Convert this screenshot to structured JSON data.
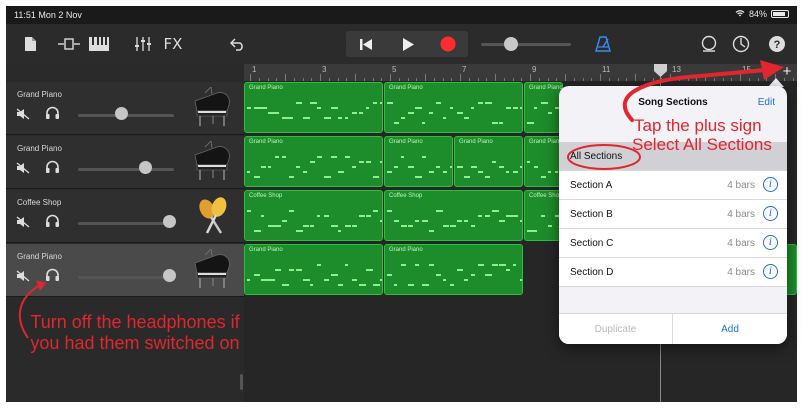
{
  "status_bar": {
    "time_date": "11:51  Mon 2 Nov",
    "battery": "84%"
  },
  "toolbar": {
    "fx_label": "FX"
  },
  "ruler": {
    "bars": [
      "1",
      "3",
      "5",
      "7",
      "9",
      "11",
      "13",
      "15"
    ]
  },
  "tracks": [
    {
      "name": "Grand Piano",
      "instrument": "grand-piano",
      "volume": 0.45
    },
    {
      "name": "Grand Piano",
      "instrument": "grand-piano",
      "volume": 0.7
    },
    {
      "name": "Coffee Shop",
      "instrument": "maracas",
      "volume": 0.95
    },
    {
      "name": "Grand Piano",
      "instrument": "grand-piano",
      "volume": 0.95,
      "selected": true
    }
  ],
  "regions": [
    {
      "track": 0,
      "label": "Grand Piano"
    },
    {
      "track": 0,
      "label": "Grand Piano"
    },
    {
      "track": 0,
      "label": "Grand Piano"
    },
    {
      "track": 1,
      "label": "Grand Piano"
    },
    {
      "track": 1,
      "label": "Grand Piano"
    },
    {
      "track": 1,
      "label": "Grand Piano"
    },
    {
      "track": 1,
      "label": "Grand Piano"
    },
    {
      "track": 2,
      "label": "Coffee Shop"
    },
    {
      "track": 2,
      "label": "Coffee Shop"
    },
    {
      "track": 2,
      "label": "Coffee Shop"
    },
    {
      "track": 3,
      "label": "Grand Piano"
    },
    {
      "track": 3,
      "label": "Grand Piano"
    }
  ],
  "song_sections": {
    "title": "Song Sections",
    "edit_label": "Edit",
    "all_sections_label": "All Sections",
    "sections": [
      {
        "name": "Section A",
        "length": "4 bars"
      },
      {
        "name": "Section B",
        "length": "4 bars"
      },
      {
        "name": "Section C",
        "length": "4 bars"
      },
      {
        "name": "Section D",
        "length": "4 bars"
      }
    ],
    "duplicate_label": "Duplicate",
    "add_label": "Add"
  },
  "annotations": {
    "plus_line": "Tap the plus sign",
    "select_line": "Select All Sections",
    "headphones_text": "Turn off the headphones if you had them switched on"
  },
  "colors": {
    "region_green": "#1d8c2a",
    "annotation_red": "#e0262e",
    "link_blue": "#1a6fdc"
  }
}
